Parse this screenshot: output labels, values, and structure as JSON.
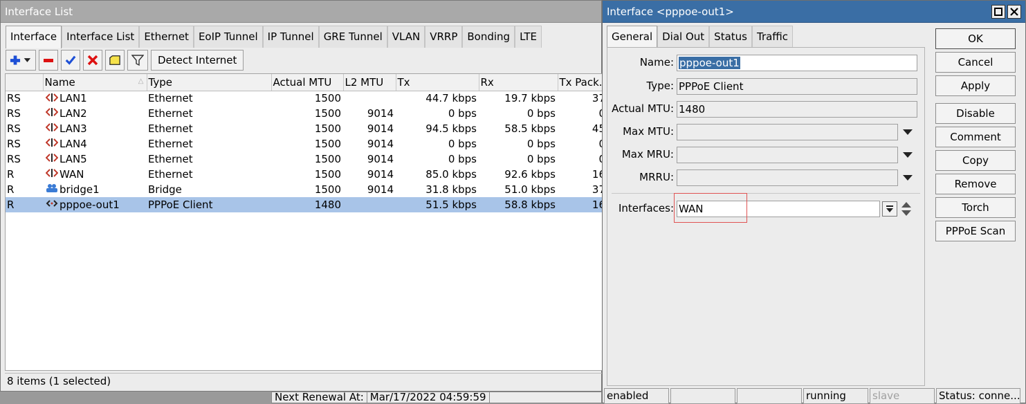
{
  "left_window": {
    "title": "Interface List",
    "tabs": [
      "Interface",
      "Interface List",
      "Ethernet",
      "EoIP Tunnel",
      "IP Tunnel",
      "GRE Tunnel",
      "VLAN",
      "VRRP",
      "Bonding",
      "LTE"
    ],
    "active_tab": "Interface",
    "toolbar": {
      "icons": [
        "add-icon",
        "remove-icon",
        "enable-check-icon",
        "disable-x-icon",
        "comment-icon",
        "filter-icon"
      ],
      "detect_label": "Detect Internet"
    },
    "table": {
      "columns": [
        "",
        "Name",
        "Type",
        "Actual MTU",
        "L2 MTU",
        "Tx",
        "Rx",
        "Tx Pack..."
      ],
      "rows": [
        {
          "flags": "RS",
          "icon": "ethernet-icon",
          "name": "LAN1",
          "type": "Ethernet",
          "mtu": "1500",
          "l2mtu": "",
          "tx": "44.7 kbps",
          "rx": "19.7 kbps",
          "txp": "37"
        },
        {
          "flags": "RS",
          "icon": "ethernet-icon",
          "name": "LAN2",
          "type": "Ethernet",
          "mtu": "1500",
          "l2mtu": "9014",
          "tx": "0 bps",
          "rx": "0 bps",
          "txp": "0"
        },
        {
          "flags": "RS",
          "icon": "ethernet-icon",
          "name": "LAN3",
          "type": "Ethernet",
          "mtu": "1500",
          "l2mtu": "9014",
          "tx": "94.5 kbps",
          "rx": "58.5 kbps",
          "txp": "45"
        },
        {
          "flags": "RS",
          "icon": "ethernet-icon",
          "name": "LAN4",
          "type": "Ethernet",
          "mtu": "1500",
          "l2mtu": "9014",
          "tx": "0 bps",
          "rx": "0 bps",
          "txp": "0"
        },
        {
          "flags": "RS",
          "icon": "ethernet-icon",
          "name": "LAN5",
          "type": "Ethernet",
          "mtu": "1500",
          "l2mtu": "9014",
          "tx": "0 bps",
          "rx": "0 bps",
          "txp": "0"
        },
        {
          "flags": "R",
          "icon": "ethernet-icon",
          "name": "WAN",
          "type": "Ethernet",
          "mtu": "1500",
          "l2mtu": "9014",
          "tx": "85.0 kbps",
          "rx": "92.6 kbps",
          "txp": "16"
        },
        {
          "flags": "R",
          "icon": "bridge-icon",
          "name": "bridge1",
          "type": "Bridge",
          "mtu": "1500",
          "l2mtu": "9014",
          "tx": "31.8 kbps",
          "rx": "51.0 kbps",
          "txp": "37"
        },
        {
          "flags": "R",
          "icon": "pppoe-icon",
          "name": "pppoe-out1",
          "type": "PPPoE Client",
          "mtu": "1480",
          "l2mtu": "",
          "tx": "51.5 kbps",
          "rx": "58.8 kbps",
          "txp": "16",
          "selected": true
        }
      ]
    },
    "status": "8 items (1 selected)",
    "renewal": {
      "label": "Next Renewal At:",
      "value": "Mar/17/2022 04:59:59"
    }
  },
  "dialog": {
    "title": "Interface <pppoe-out1>",
    "tabs": [
      "General",
      "Dial Out",
      "Status",
      "Traffic"
    ],
    "active_tab": "General",
    "fields": {
      "name": {
        "label": "Name:",
        "value": "pppoe-out1"
      },
      "type": {
        "label": "Type:",
        "value": "PPPoE Client"
      },
      "actual_mtu": {
        "label": "Actual MTU:",
        "value": "1480"
      },
      "max_mtu": {
        "label": "Max MTU:",
        "value": ""
      },
      "max_mru": {
        "label": "Max MRU:",
        "value": ""
      },
      "mrru": {
        "label": "MRRU:",
        "value": ""
      },
      "interfaces": {
        "label": "Interfaces:",
        "value": "WAN"
      }
    },
    "buttons": {
      "ok": "OK",
      "cancel": "Cancel",
      "apply": "Apply",
      "disable": "Disable",
      "comment": "Comment",
      "copy": "Copy",
      "remove": "Remove",
      "torch": "Torch",
      "pppoe_scan": "PPPoE Scan"
    },
    "status_bar": {
      "state": "enabled",
      "s2": "",
      "s3": "",
      "running": "running",
      "slave": "slave",
      "status": "Status: conne..."
    }
  },
  "colors": {
    "selection": "#a8c4e8",
    "title_active": "#3a6ea5",
    "highlight_box": "#e05252"
  }
}
